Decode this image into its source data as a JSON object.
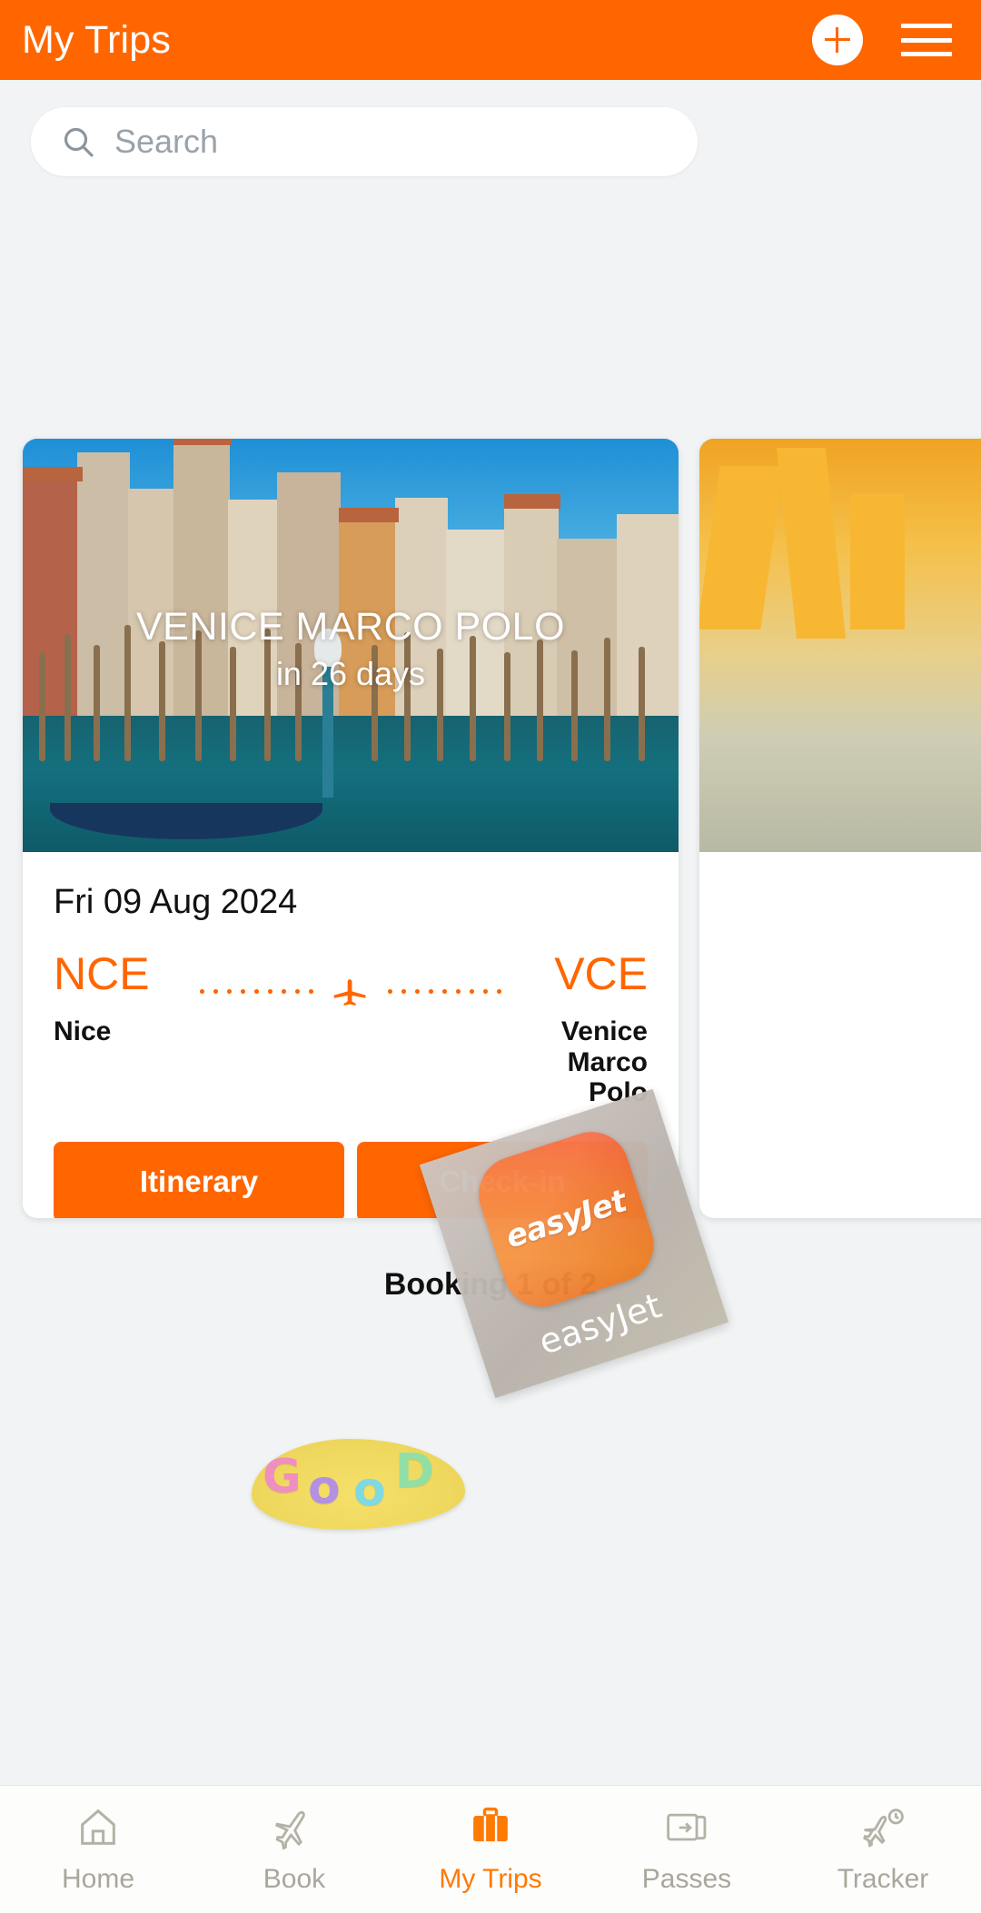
{
  "app": {
    "title": "My Trips",
    "add_icon": "plus-icon",
    "menu_icon": "hamburger-menu-icon"
  },
  "search": {
    "placeholder": "Search",
    "value": "",
    "icon": "search-icon"
  },
  "colors": {
    "brand_orange": "#ff6600",
    "page_bg": "#f1f3f4",
    "card_bg": "#ffffff",
    "nav_inactive": "#a9a79c",
    "nav_active": "#ff7a00"
  },
  "trip_card": {
    "destination": "VENICE MARCO POLO",
    "countdown": "in 26 days",
    "date": "Fri 09 Aug 2024",
    "origin_code": "NCE",
    "origin_city": "Nice",
    "destination_code": "VCE",
    "destination_city": "Venice Marco Polo",
    "plane_icon": "airplane-icon",
    "itinerary_label": "Itinerary",
    "checkin_label": "Check-in"
  },
  "overlays": {
    "airline_tile_text": "easyJet",
    "airline_label": "easyJet",
    "candy_sticker_text": "GOOD",
    "candy_letters": [
      "G",
      "o",
      "o",
      "D"
    ]
  },
  "pagination": {
    "label": "Booking 1 of 2"
  },
  "bottom_nav": {
    "items": [
      {
        "label": "Home",
        "icon": "home-icon",
        "active": false
      },
      {
        "label": "Book",
        "icon": "airplane-book-icon",
        "active": false
      },
      {
        "label": "My Trips",
        "icon": "suitcase-icon",
        "active": true
      },
      {
        "label": "Passes",
        "icon": "boarding-pass-icon",
        "active": false
      },
      {
        "label": "Tracker",
        "icon": "flight-tracker-clock-icon",
        "active": false
      }
    ]
  }
}
